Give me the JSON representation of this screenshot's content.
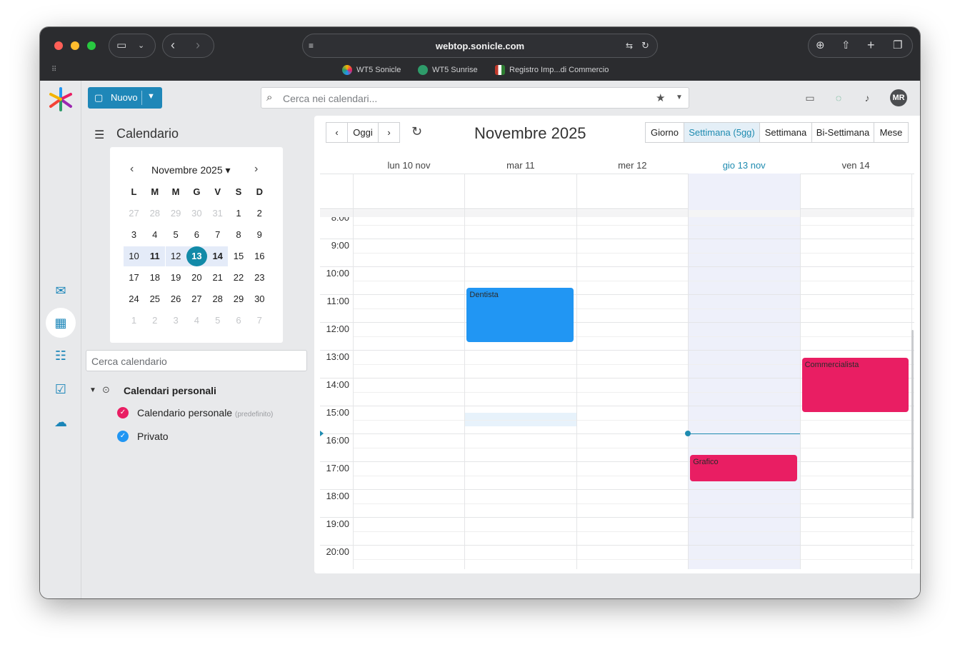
{
  "browser": {
    "url": "webtop.sonicle.com",
    "bookmarks": [
      {
        "label": "WT5 Sonicle",
        "color": "#f4b400"
      },
      {
        "label": "WT5 Sunrise",
        "color": "#2e9c6a"
      },
      {
        "label": "Registro Imp...di Commercio",
        "color": "#c0392b"
      }
    ]
  },
  "toolbar": {
    "new_label": "Nuovo",
    "search_placeholder": "Cerca nei calendari...",
    "avatar_initials": "MR"
  },
  "sidebar": {
    "title": "Calendario",
    "minical": {
      "title": "Novembre 2025",
      "weekdays": [
        "L",
        "M",
        "M",
        "G",
        "V",
        "S",
        "D"
      ],
      "weeks": [
        [
          "27",
          "28",
          "29",
          "30",
          "31",
          "1",
          "2"
        ],
        [
          "3",
          "4",
          "5",
          "6",
          "7",
          "8",
          "9"
        ],
        [
          "10",
          "11",
          "12",
          "13",
          "14",
          "15",
          "16"
        ],
        [
          "17",
          "18",
          "19",
          "20",
          "21",
          "22",
          "23"
        ],
        [
          "24",
          "25",
          "26",
          "27",
          "28",
          "29",
          "30"
        ],
        [
          "1",
          "2",
          "3",
          "4",
          "5",
          "6",
          "7"
        ]
      ],
      "today": "13"
    },
    "calendar_search_placeholder": "Cerca calendario",
    "group_label": "Calendari personali",
    "calendars": [
      {
        "label": "Calendario personale",
        "note": "(predefinito)",
        "color": "#e91e63"
      },
      {
        "label": "Privato",
        "note": "",
        "color": "#2196f3"
      }
    ]
  },
  "main": {
    "today_label": "Oggi",
    "title": "Novembre 2025",
    "views": [
      "Giorno",
      "Settimana (5gg)",
      "Settimana",
      "Bi-Settimana",
      "Mese"
    ],
    "active_view": "Settimana (5gg)",
    "days": [
      "lun 10 nov",
      "mar 11",
      "mer 12",
      "gio 13 nov",
      "ven 14"
    ],
    "today_index": 3,
    "hours": [
      "8:00",
      "9:00",
      "10:00",
      "11:00",
      "12:00",
      "13:00",
      "14:00",
      "15:00",
      "16:00",
      "17:00",
      "18:00",
      "19:00",
      "20:00"
    ],
    "events": [
      {
        "title": "Dentista",
        "day": 1,
        "start": 10.5,
        "end": 12.5,
        "color": "#2196f3"
      },
      {
        "title": "Commercialista",
        "day": 4,
        "start": 13.0,
        "end": 15.0,
        "color": "#e91e63"
      },
      {
        "title": "Grafico",
        "day": 3,
        "start": 16.5,
        "end": 17.5,
        "color": "#e91e63"
      }
    ],
    "now_hour": 15.75
  }
}
